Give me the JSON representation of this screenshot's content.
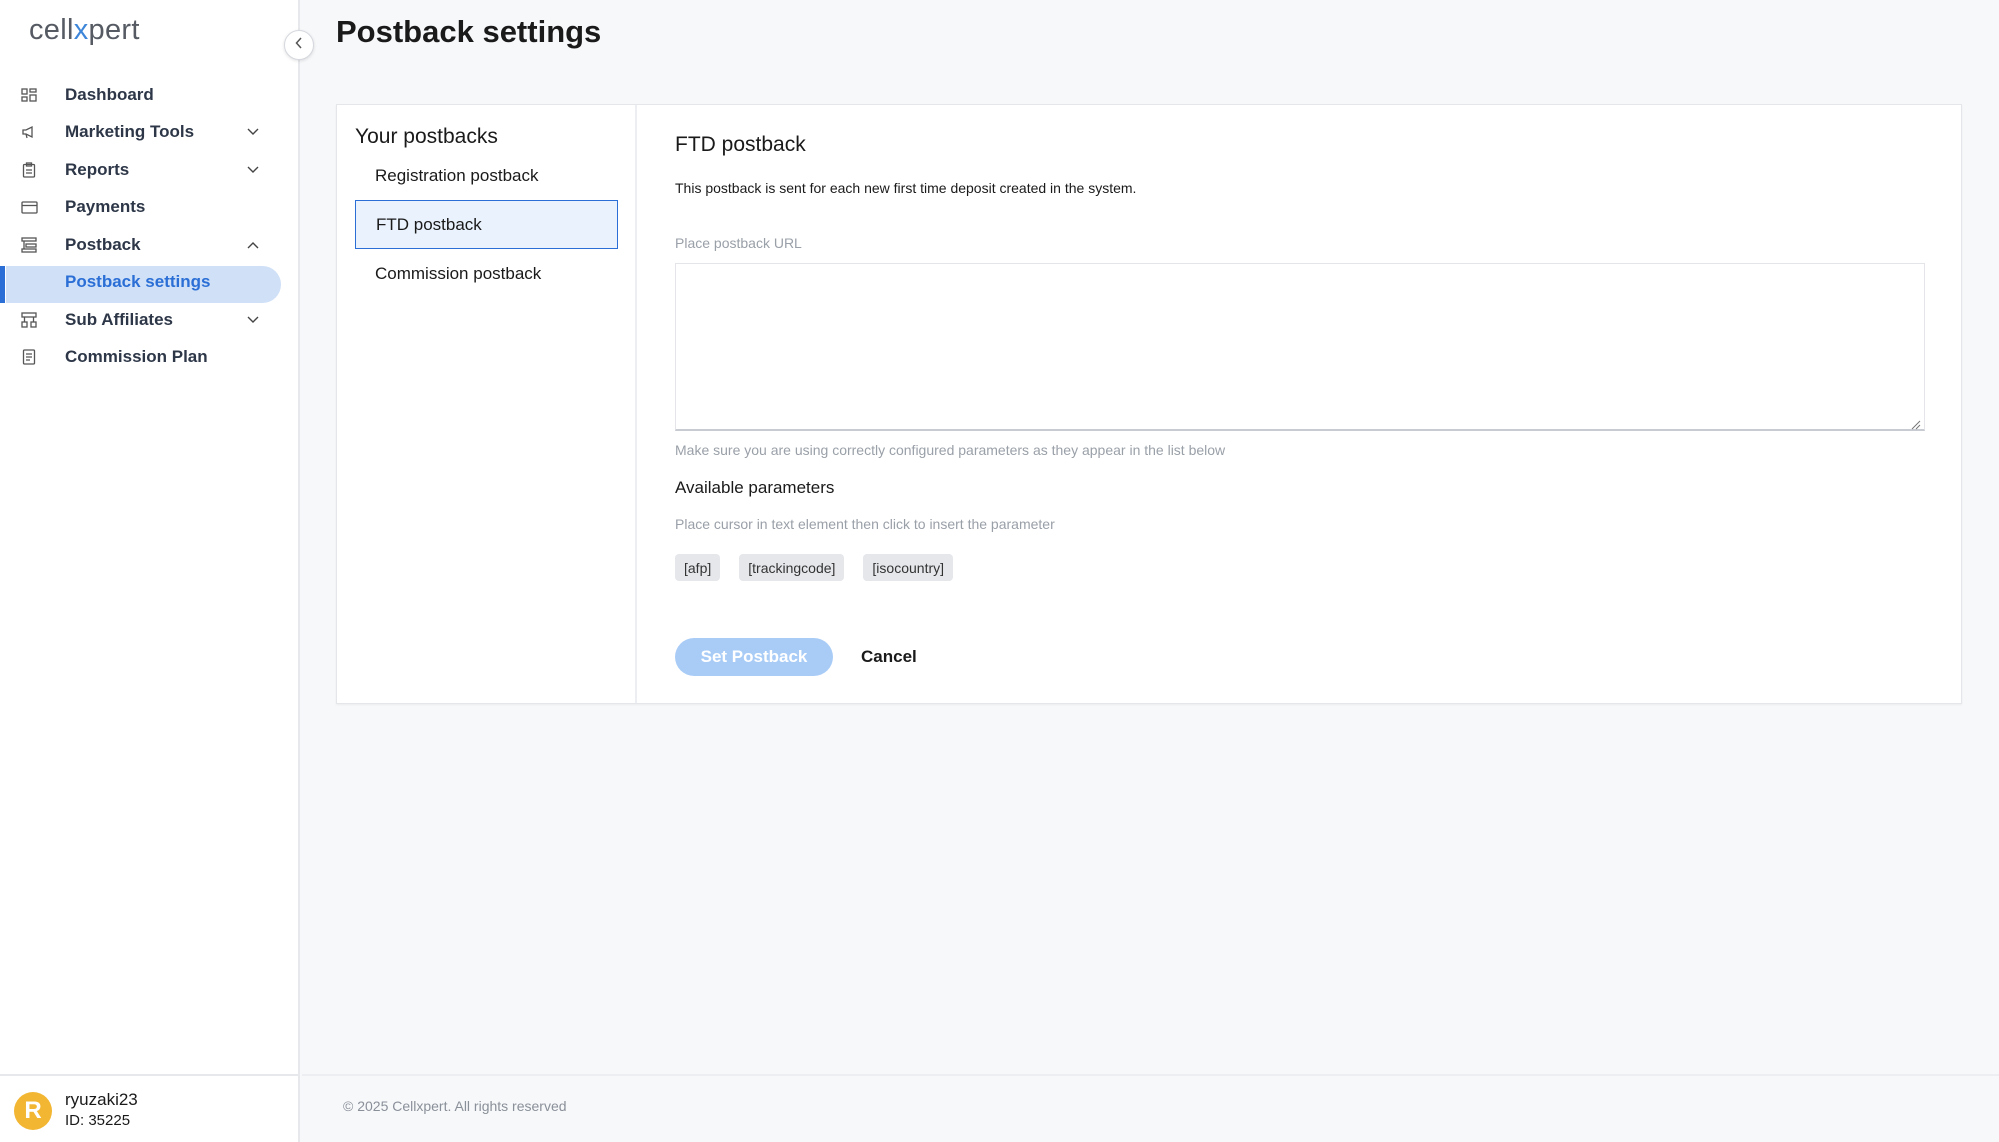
{
  "app": {
    "logo_prefix": "cell",
    "logo_x": "x",
    "logo_suffix": "pert"
  },
  "sidebar": {
    "items": [
      {
        "label": "Dashboard",
        "icon": "dashboard-icon",
        "expandable": false
      },
      {
        "label": "Marketing Tools",
        "icon": "megaphone-icon",
        "expandable": true,
        "expanded": false
      },
      {
        "label": "Reports",
        "icon": "clipboard-icon",
        "expandable": true,
        "expanded": false
      },
      {
        "label": "Payments",
        "icon": "credit-card-icon",
        "expandable": false
      },
      {
        "label": "Postback",
        "icon": "postback-icon",
        "expandable": true,
        "expanded": true
      },
      {
        "label": "Postback settings",
        "sub": true,
        "active": true
      },
      {
        "label": "Sub Affiliates",
        "icon": "sub-affiliates-icon",
        "expandable": true,
        "expanded": false
      },
      {
        "label": "Commission Plan",
        "icon": "document-icon",
        "expandable": false
      }
    ]
  },
  "user": {
    "avatar_letter": "R",
    "name": "ryuzaki23",
    "id_text": "ID: 35225",
    "avatar_color": "#f2b632"
  },
  "page": {
    "title": "Postback settings"
  },
  "postbacks": {
    "list_title": "Your postbacks",
    "items": [
      {
        "label": "Registration postback",
        "active": false
      },
      {
        "label": "FTD postback",
        "active": true
      },
      {
        "label": "Commission postback",
        "active": false
      }
    ]
  },
  "detail": {
    "title": "FTD postback",
    "description": "This postback is sent for each new first time deposit created in the system.",
    "url_label": "Place postback URL",
    "url_value": "",
    "hint": "Make sure you are using correctly configured parameters as they appear in the list below",
    "params_title": "Available parameters",
    "params_hint": "Place cursor in text element then click to insert the parameter",
    "params": [
      "[afp]",
      "[trackingcode]",
      "[isocountry]"
    ],
    "set_button": "Set Postback",
    "cancel_button": "Cancel"
  },
  "footer": {
    "text": "© 2025 Cellxpert. All rights reserved"
  },
  "colors": {
    "accent": "#2b6fd6",
    "active_pill": "#cfe0f7",
    "disabled_button": "#a9ccf7"
  }
}
